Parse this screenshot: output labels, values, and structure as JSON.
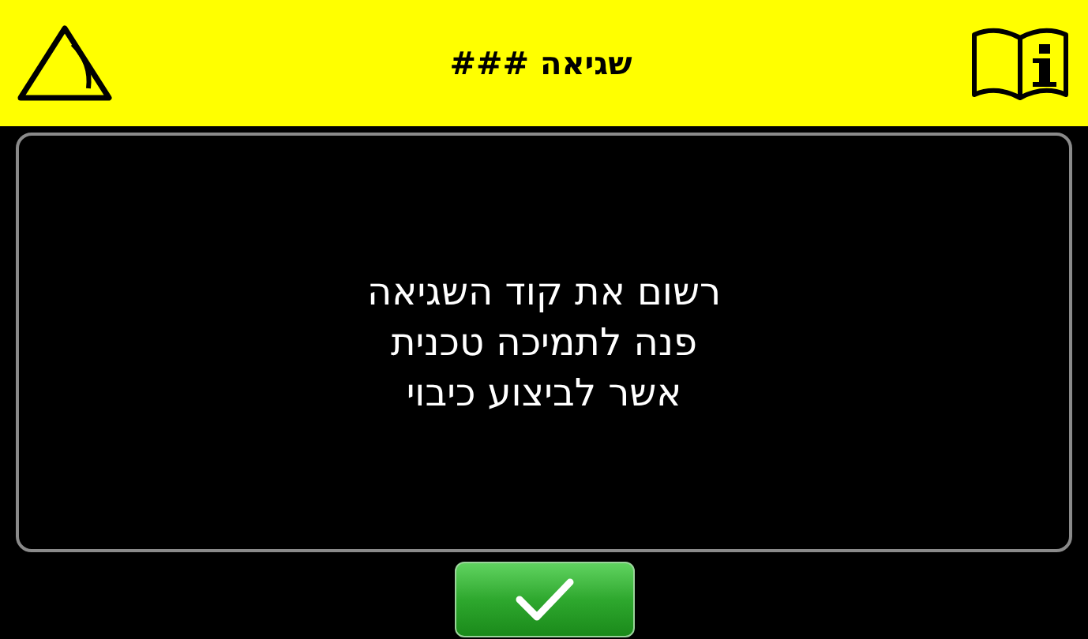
{
  "header": {
    "title": "שגיאה ###"
  },
  "message": {
    "lines": [
      "רשום את קוד השגיאה",
      "פנה לתמיכה טכנית",
      "אשר לביצוע כיבוי"
    ]
  },
  "confirm_button": {
    "kind": "check"
  }
}
